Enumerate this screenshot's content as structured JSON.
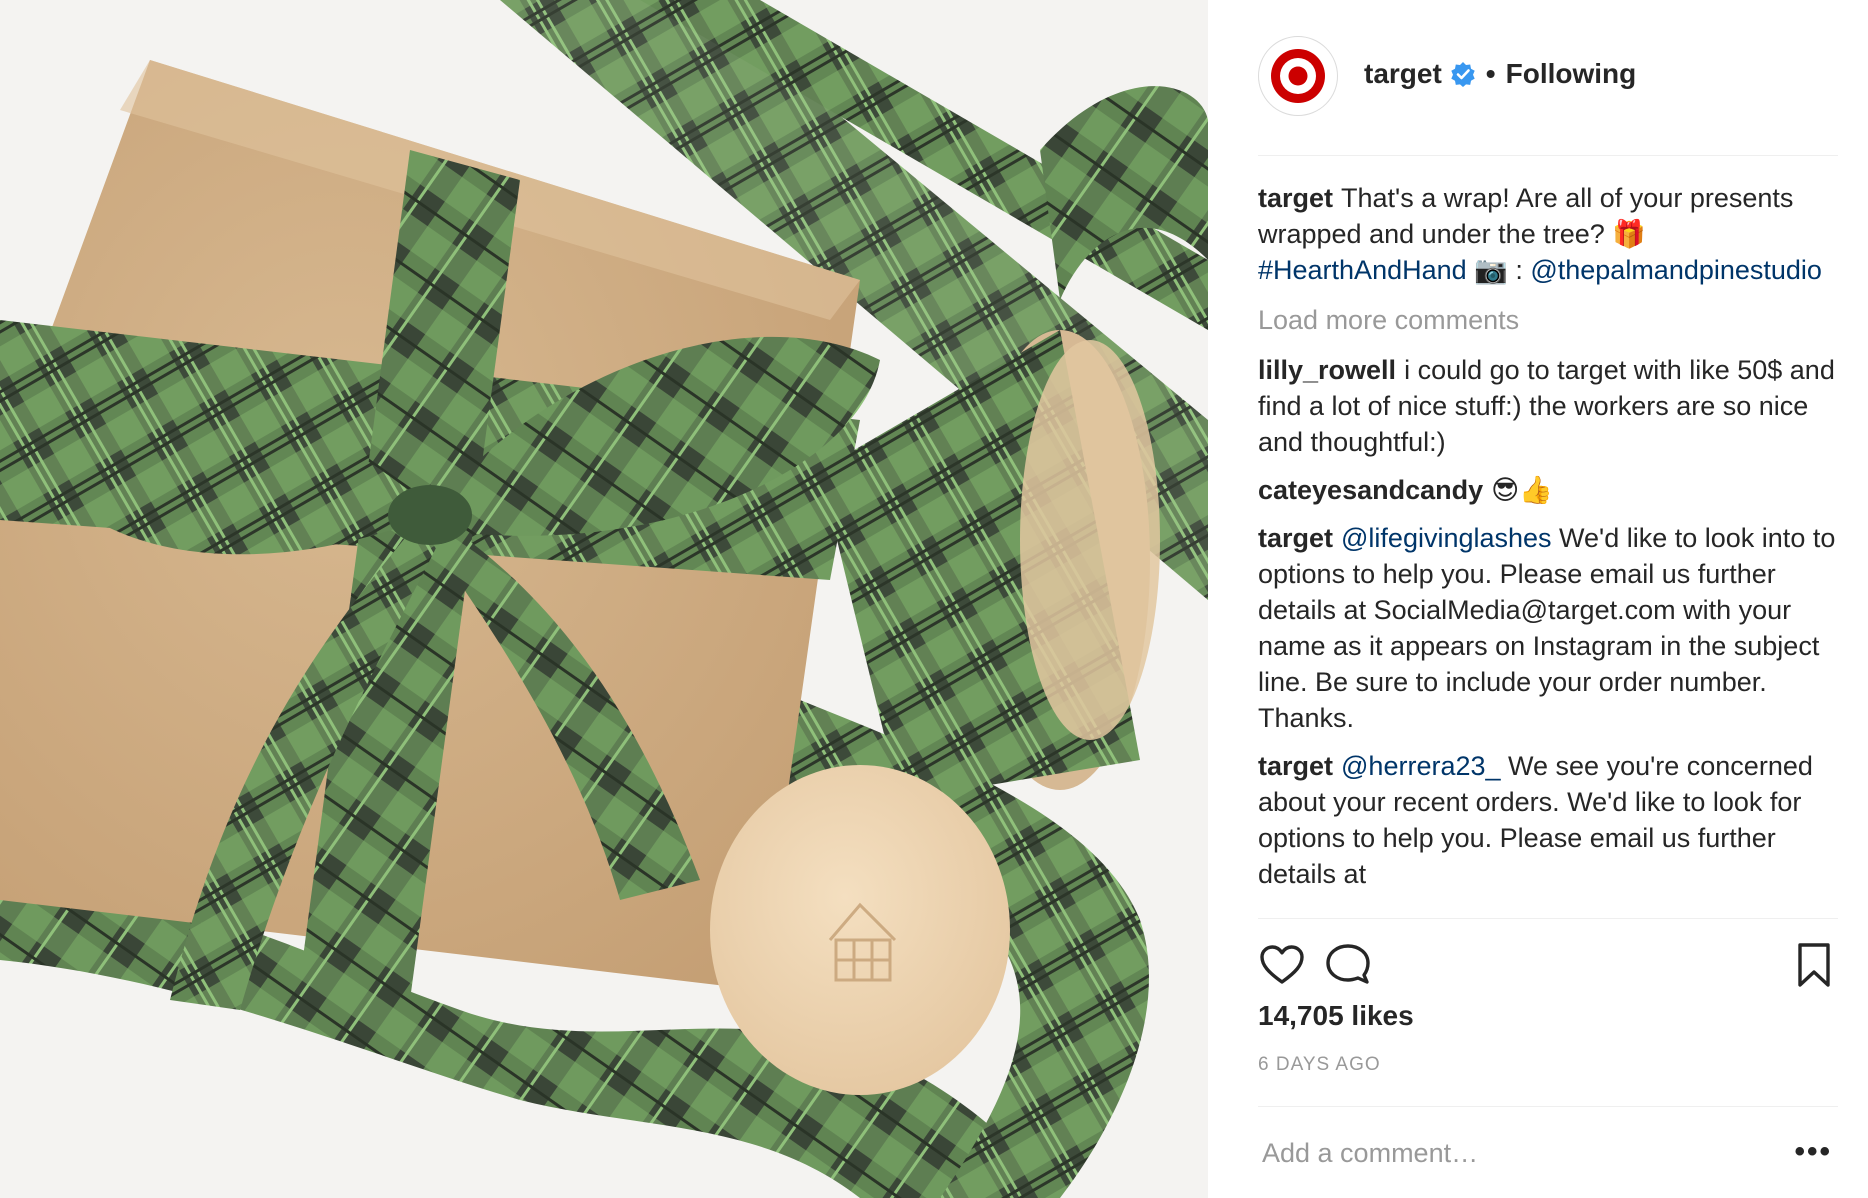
{
  "account": {
    "username": "target",
    "separator": "•",
    "follow_status": "Following"
  },
  "caption": {
    "username": "target",
    "text": "That's a wrap! Are all of your presents wrapped and under the tree? 🎁",
    "hashtag": "#HearthAndHand",
    "camera_emoji": "📷",
    "colon": ":",
    "mention": "@thepalmandpinestudio"
  },
  "load_more_label": "Load more comments",
  "comments": [
    {
      "username": "lilly_rowell",
      "text": "i could go to target with like 50$ and find a lot of nice stuff:) the workers are so nice and thoughtful:)"
    },
    {
      "username": "cateyesandcandy",
      "text": "😎👍"
    },
    {
      "username": "target",
      "mention": "@lifegivinglashes",
      "text": "We'd like to look into to options to help you. Please email us further details at SocialMedia@target.com with your name as it appears on Instagram in the subject line. Be sure to include your order number. Thanks."
    },
    {
      "username": "target",
      "mention": "@herrera23_",
      "text": "We see you're concerned about your recent orders. We'd like to look for options to help you. Please email us further details at"
    }
  ],
  "likes_label": "14,705 likes",
  "time_ago": "6 DAYS AGO",
  "add_comment_placeholder": "Add a comment…",
  "more_label": "•••",
  "icons": {
    "avatar": "target-logo-icon",
    "verified": "verified-badge-icon",
    "like": "heart-icon",
    "comment": "comment-bubble-icon",
    "save": "bookmark-icon",
    "more": "more-dots-icon"
  },
  "colors": {
    "brand_red": "#cc0000",
    "verified_blue": "#3897f0",
    "link": "#003569",
    "muted": "#999999",
    "text": "#262626"
  }
}
